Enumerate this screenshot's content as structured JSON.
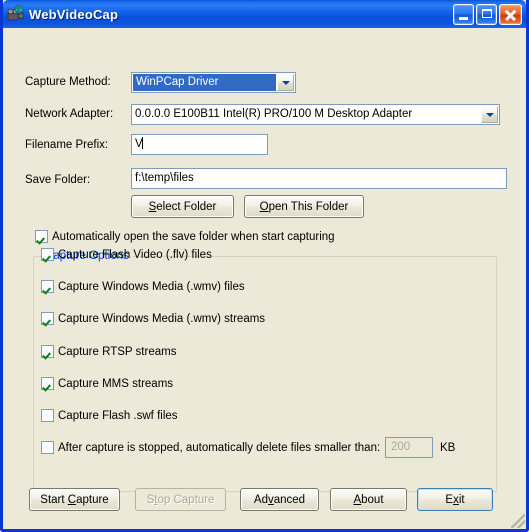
{
  "window": {
    "title": "WebVideoCap",
    "icon": "video-camera-globe-icon",
    "minimize_label": "Minimize",
    "maximize_label": "Maximize",
    "close_label": "Close",
    "accent_color": "#0a36d4",
    "face_color": "#ece9d8"
  },
  "form": {
    "capture_method": {
      "label": "Capture Method:",
      "value": "WinPCap Driver",
      "selected": true
    },
    "network_adapter": {
      "label": "Network Adapter:",
      "value": "0.0.0.0   E100B11 Intel(R) PRO/100 M Desktop Adapter"
    },
    "filename_prefix": {
      "label": "Filename Prefix:",
      "value": "V"
    },
    "save_folder": {
      "label": "Save Folder:",
      "value": "f:\\temp\\files"
    },
    "select_folder_button": "Select Folder",
    "open_folder_button": "Open This Folder",
    "auto_open": {
      "label": "Automatically open the save folder when start capturing",
      "checked": true
    }
  },
  "capture_options": {
    "group_label": "Capture Options",
    "group_label_color": "#0046d5",
    "items": [
      {
        "label": "Capture Flash Video (.flv) files",
        "checked": true
      },
      {
        "label": "Capture Windows Media (.wmv) files",
        "checked": true
      },
      {
        "label": "Capture Windows Media (.wmv) streams",
        "checked": true
      },
      {
        "label": "Capture RTSP streams",
        "checked": true
      },
      {
        "label": "Capture MMS streams",
        "checked": true
      },
      {
        "label": "Capture Flash .swf files",
        "checked": false
      }
    ],
    "delete_small": {
      "label": "After capture is stopped, automatically delete files smaller than:",
      "checked": false,
      "size_value": "200",
      "unit": "KB",
      "disabled": true
    }
  },
  "buttons": {
    "start_capture": {
      "label": "Start Capture",
      "accel": "C",
      "disabled": false
    },
    "stop_capture": {
      "label": "Stop Capture",
      "accel": "t",
      "disabled": true
    },
    "advanced": {
      "label": "Advanced",
      "accel": "v",
      "disabled": false
    },
    "about": {
      "label": "About",
      "accel": "A",
      "disabled": false
    },
    "exit": {
      "label": "Exit",
      "accel": "x",
      "disabled": false,
      "default": true
    }
  }
}
